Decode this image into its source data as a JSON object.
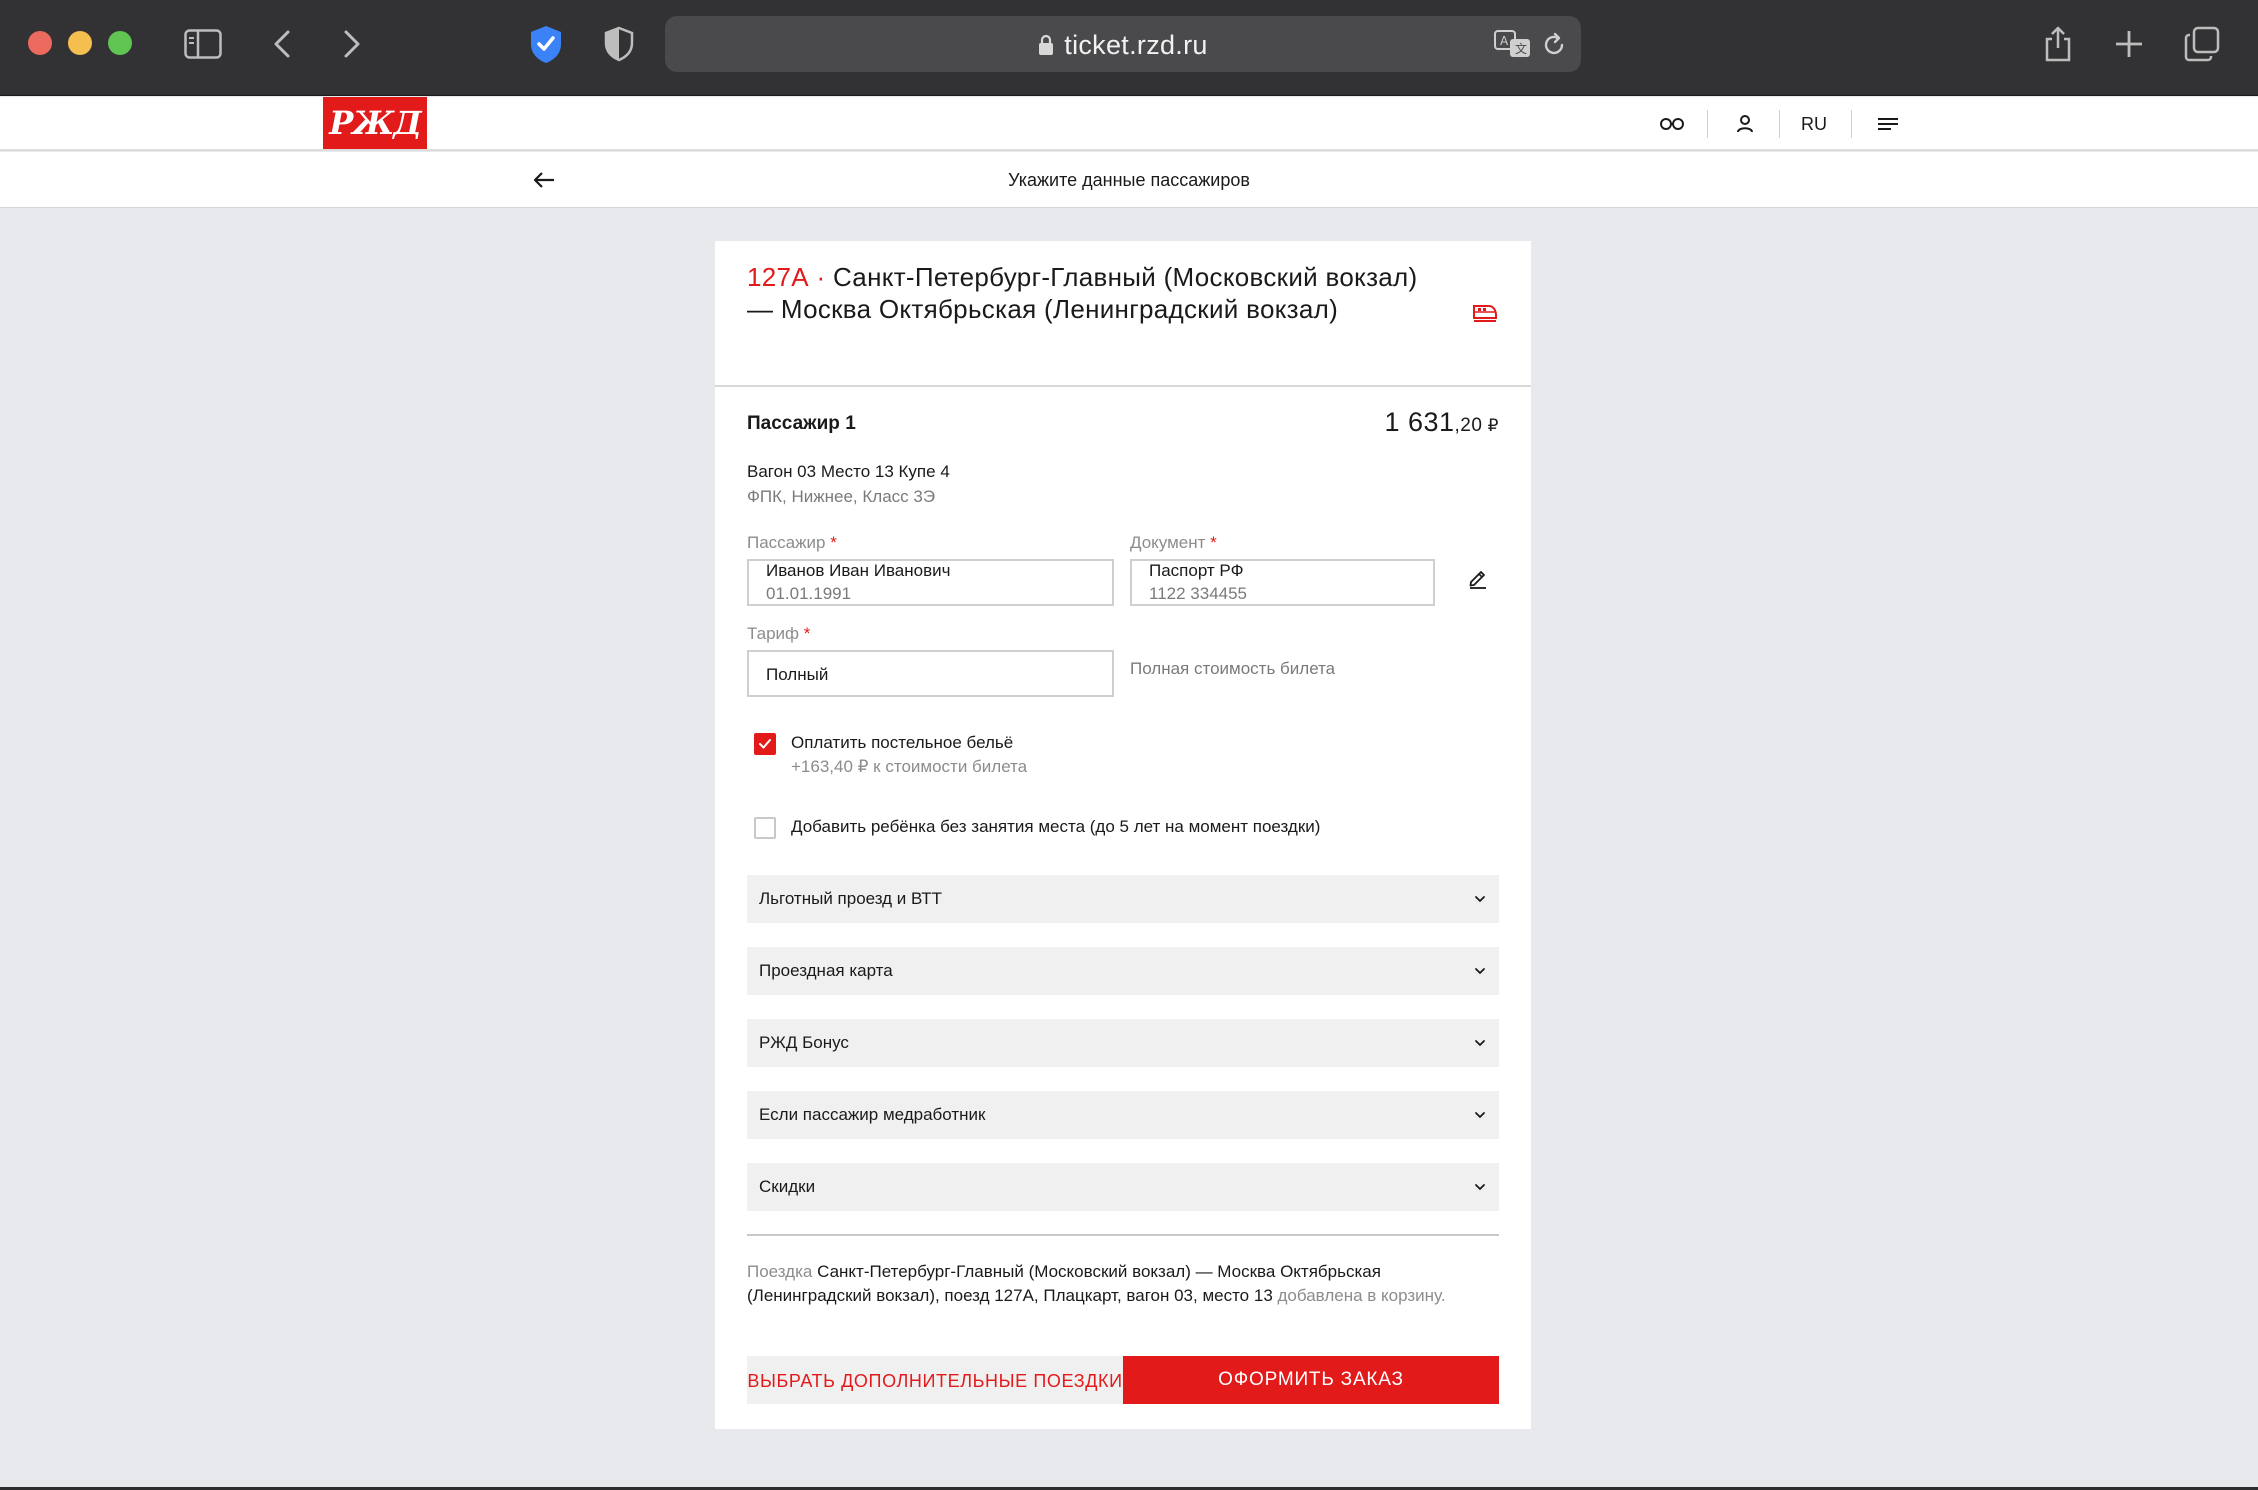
{
  "browser": {
    "url": "ticket.rzd.ru"
  },
  "site": {
    "logo_text": "РЖД",
    "lang": "RU"
  },
  "subheader": {
    "title": "Укажите данные пассажиров"
  },
  "trip": {
    "train_number": "127А",
    "separator": " · ",
    "route": "Санкт-Петербург-Главный (Московский вокзал) — Москва Октябрьская (Ленинградский вокзал)"
  },
  "passenger": {
    "title": "Пассажир 1",
    "price_main": "1 631",
    "price_kop": ",20",
    "price_currency": " ₽",
    "seat_line": "Вагон 03 Место 13 Купе 4",
    "seat_details": "ФПК, Нижнее, Класс 3Э",
    "fields": {
      "passenger_label": "Пассажир",
      "passenger_name": "Иванов Иван Иванович",
      "passenger_birth": "01.01.1991",
      "document_label": "Документ",
      "document_type": "Паспорт РФ",
      "document_number": "1122 334455",
      "tariff_label": "Тариф",
      "tariff_value": "Полный",
      "tariff_note": "Полная стоимость билета",
      "required_mark": "*"
    },
    "linen": {
      "checked": true,
      "label": "Оплатить постельное бельё",
      "sub": "+163,40 ₽ к стоимости билета"
    },
    "child": {
      "checked": false,
      "label": "Добавить ребёнка без занятия места (до 5 лет на момент поездки)"
    },
    "accordions": [
      "Льготный проезд и ВТТ",
      "Проездная карта",
      "РЖД Бонус",
      "Если пассажир медработник",
      "Скидки"
    ]
  },
  "basket": {
    "prefix": "Поездка",
    "text": " Санкт-Петербург-Главный (Московский вокзал) — Москва Октябрьская (Ленинградский вокзал), поезд 127А, Плацкарт, вагон 03, место 13 ",
    "suffix": "добавлена в корзину."
  },
  "buttons": {
    "more_trips": "ВЫБРАТЬ ДОПОЛНИТЕЛЬНЫЕ ПОЕЗДКИ",
    "checkout": "ОФОРМИТЬ ЗАКАЗ"
  },
  "colors": {
    "brand_red": "#e21a1a",
    "background": "#e8e9ed",
    "chrome": "#323234"
  }
}
